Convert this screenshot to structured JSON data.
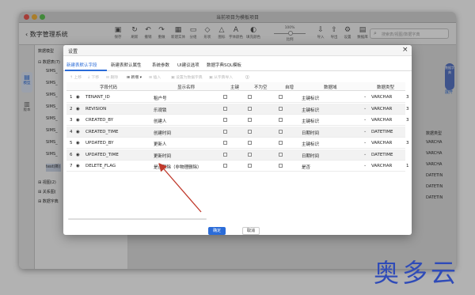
{
  "window": {
    "title": "当前项目为模板项目"
  },
  "toolbar": {
    "back_label": "数字管理系统",
    "items": [
      {
        "label": "保存",
        "icon": "save-icon",
        "glyph": "▣"
      },
      {
        "label": "刷新",
        "icon": "refresh-icon",
        "glyph": "↻"
      },
      {
        "label": "撤销",
        "icon": "undo-icon",
        "glyph": "↶"
      },
      {
        "label": "重做",
        "icon": "redo-icon",
        "glyph": "↷"
      },
      {
        "label": "新建实体",
        "icon": "new-entity-icon",
        "glyph": "▦"
      },
      {
        "label": "分组",
        "icon": "group-icon",
        "glyph": "▭"
      },
      {
        "label": "形状",
        "icon": "shape-icon",
        "glyph": "◇"
      },
      {
        "label": "图标",
        "icon": "icon-icon",
        "glyph": "△"
      },
      {
        "label": "字体颜色",
        "icon": "font-color-icon",
        "glyph": "A"
      },
      {
        "label": "填充颜色",
        "icon": "fill-color-icon",
        "glyph": "◐"
      },
      {
        "label": "导入",
        "icon": "import-icon",
        "glyph": "⇩"
      },
      {
        "label": "导出",
        "icon": "export-icon",
        "glyph": "⇧"
      },
      {
        "label": "设置",
        "icon": "settings-icon",
        "glyph": "⚙"
      },
      {
        "label": "数据库",
        "icon": "database-icon",
        "glyph": "▤"
      }
    ],
    "zoom_value": "100%",
    "zoom_label": "比例",
    "search_placeholder": "搜索表/视图/数据字典"
  },
  "left_rail": [
    {
      "label": "模型",
      "icon": "model-icon"
    },
    {
      "label": "版本",
      "icon": "version-icon"
    }
  ],
  "tree": {
    "root": "数据表(7)",
    "model_label": "数据模型",
    "items": [
      "SIMS_",
      "SIMS_",
      "SIMS_",
      "SIMS_",
      "SIMS_",
      "SIMS_",
      "SIMS_",
      "SIMS_",
      "test(新)"
    ],
    "views": "视图(2)",
    "relations": "关系图(",
    "dict": "数据字典"
  },
  "background_right": {
    "expand": "展开",
    "header": "数据类型",
    "values": [
      "VARCHA",
      "VARCHA",
      "VARCHA",
      "DATETIN",
      "DATETIN",
      "DATETIN"
    ]
  },
  "side_badge": "数据字典",
  "dialog": {
    "title": "设置",
    "close": "×",
    "tabs": [
      "新建表默认字段",
      "新建表默认属性",
      "系统参数",
      "UI建议选项",
      "数据字典SQL模板"
    ],
    "actions": [
      {
        "label": "上移",
        "enabled": false
      },
      {
        "label": "下移",
        "enabled": false
      },
      {
        "label": "删除",
        "enabled": false
      },
      {
        "label": "新增",
        "enabled": true
      },
      {
        "label": "插入",
        "enabled": false
      },
      {
        "label": "设置为数据字典",
        "enabled": false
      },
      {
        "label": "从字典导入",
        "enabled": false
      }
    ],
    "columns": [
      "字段代码",
      "显示名称",
      "主键",
      "不为空",
      "自增",
      "数据域",
      "数据类型"
    ],
    "rows": [
      {
        "no": "1",
        "code": "TENANT_ID",
        "name": "租户号",
        "domain": "主键标识",
        "type": "VARCHAR",
        "extra": "3"
      },
      {
        "no": "2",
        "code": "REVISION",
        "name": "乐观锁",
        "domain": "主键标识",
        "type": "VARCHAR",
        "extra": "3"
      },
      {
        "no": "3",
        "code": "CREATED_BY",
        "name": "创建人",
        "domain": "主键标识",
        "type": "VARCHAR",
        "extra": "3"
      },
      {
        "no": "4",
        "code": "CREATED_TIME",
        "name": "创建时间",
        "domain": "日期时间",
        "type": "DATETIME",
        "extra": ""
      },
      {
        "no": "5",
        "code": "UPDATED_BY",
        "name": "更新人",
        "domain": "主键标识",
        "type": "VARCHAR",
        "extra": "3"
      },
      {
        "no": "6",
        "code": "UPDATED_TIME",
        "name": "更新时间",
        "domain": "日期时间",
        "type": "DATETIME",
        "extra": ""
      },
      {
        "no": "7",
        "code": "DELETE_FLAG",
        "name": "是否删除（非物理删除）",
        "domain": "是否",
        "type": "VARCHAR",
        "extra": "1"
      }
    ],
    "ok_label": "确定",
    "cancel_label": "取消"
  },
  "watermark": "奥多云",
  "colors": {
    "accent": "#2b6cd8",
    "arrow": "#c0392b",
    "watermark": "#2f4bb8"
  }
}
